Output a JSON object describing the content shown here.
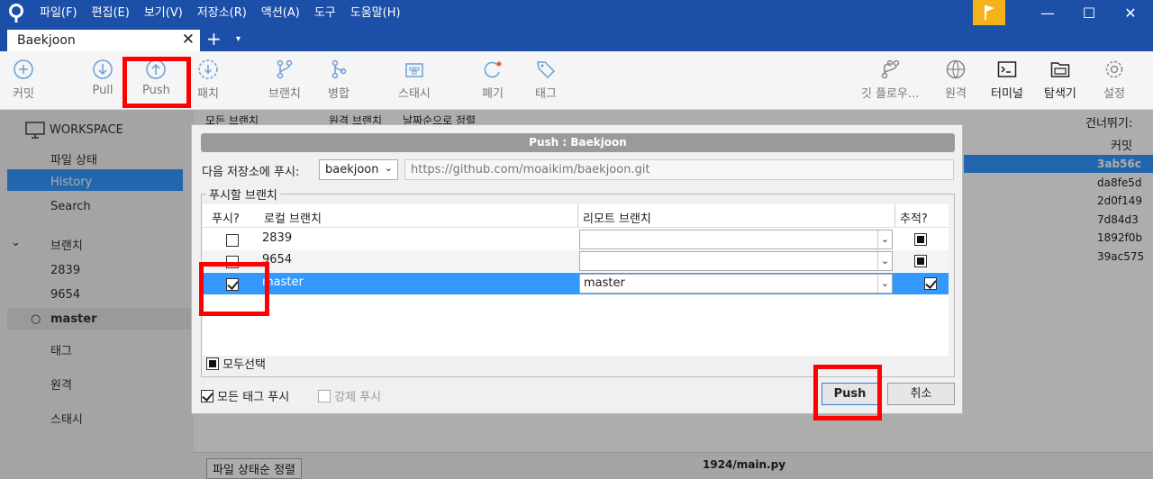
{
  "menu": [
    "파일(F)",
    "편집(E)",
    "보기(V)",
    "저장소(R)",
    "액션(A)",
    "도구",
    "도움말(H)"
  ],
  "tab": {
    "label": "Baekjoon",
    "close": "✕",
    "add": "+",
    "menu": "▾"
  },
  "window": {
    "minimize": "—",
    "maximize": "☐",
    "close": "✕"
  },
  "toolbar": {
    "commit": "커밋",
    "pull": "Pull",
    "push": "Push",
    "patch": "패치",
    "branch": "브랜치",
    "merge": "병합",
    "stash": "스태시",
    "discard": "폐기",
    "tag": "태그",
    "gitflow": "깃 플로우...",
    "remote": "원격",
    "terminal": "터미널",
    "explorer": "탐색기",
    "settings": "설정"
  },
  "sidebar": {
    "workspace": "WORKSPACE",
    "items": [
      "파일 상태",
      "History",
      "Search"
    ],
    "branches_header": "브랜치",
    "branches": [
      "2839",
      "9654",
      "master"
    ],
    "tags": "태그",
    "remotes": "원격",
    "stashes": "스태시"
  },
  "background": {
    "filter1": "모든 브랜치",
    "filter2": "원격 브랜치",
    "filter3": "날짜순으로 정렬",
    "skip": "건너뛰기:",
    "commit_col": "커밋",
    "commits": [
      "3ab56c",
      "da8fe5d",
      "2d0f149",
      "7d84d3",
      "1892f0b",
      "39ac575"
    ],
    "footer_sort": "파일 상태순 정렬",
    "footer_file": "1924/main.py"
  },
  "dialog": {
    "title": "Push :  Baekjoon",
    "repo_label": "다음 저장소에 푸시:",
    "repo_value": "baekjoon",
    "repo_url": "https://github.com/moaikim/baekjoon.git",
    "group_label": "푸시할 브랜치",
    "columns": {
      "push": "푸시?",
      "local": "로컬 브랜치",
      "remote": "리모트 브랜치",
      "track": "추적?"
    },
    "rows": [
      {
        "local": "2839",
        "remote": ""
      },
      {
        "local": "9654",
        "remote": ""
      },
      {
        "local": "master",
        "remote": "master"
      }
    ],
    "select_all": "모두선택",
    "push_all_tags": "모든 태그 푸시",
    "force_push": "강제 푸시",
    "push_button": "Push",
    "cancel_button": "취소"
  },
  "colors": {
    "titlebar": "#1b4fa8",
    "highlight": "#ff0000",
    "selection": "#3399ff"
  }
}
